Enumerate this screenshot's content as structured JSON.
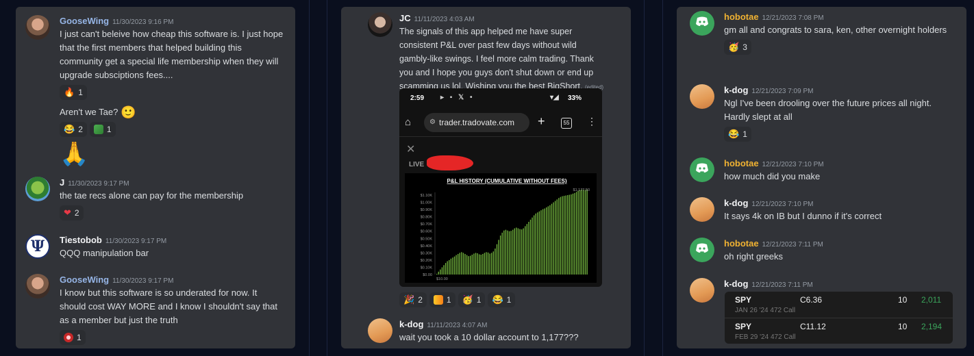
{
  "panels": {
    "left": {
      "messages": [
        {
          "author": "GooseWing",
          "timestamp": "11/30/2023 9:16 PM",
          "text": "I just can't beleive how cheap this software is.  I just hope that the first members that helped building this community get a special life membership when they will upgrade subsciptions fees....",
          "reaction": {
            "emoji": "🔥",
            "count": "1"
          },
          "followup": "Aren't we Tae?",
          "followup_emoji": "🙂",
          "followup_reactions": [
            {
              "emoji": "😂",
              "count": "2"
            },
            {
              "emoji": "custom",
              "count": "1"
            }
          ],
          "big_emoji": "🙏"
        },
        {
          "author": "J",
          "timestamp": "11/30/2023 9:17 PM",
          "text": "the tae recs alone can pay for the membership",
          "reaction": {
            "emoji": "❤",
            "count": "2"
          }
        },
        {
          "author": "Tiestobob",
          "timestamp": "11/30/2023 9:17 PM",
          "text": "QQQ manipulation bar",
          "avatar_glyph": "Ψ"
        },
        {
          "author": "GooseWing",
          "timestamp": "11/30/2023 9:17 PM",
          "text": "I know but this software is so underated for now.  It should cost WAY MORE and I know I shouldn't say that as a member but just the truth",
          "reaction": {
            "emoji": "custom",
            "count": "1"
          }
        }
      ]
    },
    "middle": {
      "messages": [
        {
          "author": "JC",
          "timestamp": "11/11/2023 4:03 AM",
          "text": "The signals of this app helped me have super consistent P&L over past few days without wild gambly-like swings. I feel more calm trading. Thank you and I hope you guys don't shut down or end up scamming us lol. Wishing you the best BigShort.",
          "edited": "(edited)",
          "reactions": [
            {
              "emoji": "🎉",
              "count": "2"
            },
            {
              "emoji": "custom",
              "count": "1"
            },
            {
              "emoji": "🥳",
              "count": "1"
            },
            {
              "emoji": "😂",
              "count": "1"
            }
          ]
        },
        {
          "author": "k-dog",
          "timestamp": "11/11/2023 4:07 AM",
          "text": "wait you took a 10 dollar account to 1,177???"
        }
      ],
      "screenshot": {
        "time": "2:59",
        "battery": "33%",
        "url": "trader.tradovate.com",
        "tabs_count": "55",
        "live_label": "LIVE"
      }
    },
    "right": {
      "messages": [
        {
          "author": "hobotae",
          "timestamp": "12/21/2023 7:08 PM",
          "text": "gm all and congrats to sara, ken, other overnight holders",
          "reaction": {
            "emoji": "🥳",
            "count": "3"
          }
        },
        {
          "author": "k-dog",
          "timestamp": "12/21/2023 7:09 PM",
          "text": "Ngl I've been drooling over the future prices all night. Hardly slept at all",
          "reaction": {
            "emoji": "😂",
            "count": "1"
          }
        },
        {
          "author": "hobotae",
          "timestamp": "12/21/2023 7:10 PM",
          "text": "how much did you make"
        },
        {
          "author": "k-dog",
          "timestamp": "12/21/2023 7:10 PM",
          "text": "It says 4k on IB but I dunno if it's correct"
        },
        {
          "author": "hobotae",
          "timestamp": "12/21/2023 7:11 PM",
          "text": "oh right greeks"
        },
        {
          "author": "k-dog",
          "timestamp": "12/21/2023 7:11 PM"
        }
      ],
      "positions": [
        {
          "symbol": "SPY",
          "strike": "C6.36",
          "qty": "10",
          "value": "2,011",
          "desc": "JAN 26 '24 472 Call"
        },
        {
          "symbol": "SPY",
          "strike": "C11.12",
          "qty": "10",
          "value": "2,194",
          "desc": "FEB 29 '24 472 Call"
        }
      ]
    }
  },
  "colors": {
    "hobotae": "#f0b232",
    "goosewing": "#96b5e6",
    "positive": "#3ba55c",
    "chart_bar": "#6fae3c"
  },
  "chart_data": {
    "type": "bar",
    "title": "P&L HISTORY (CUMULATIVE WITHOUT FEES)",
    "first_value_label": "$10.00",
    "last_value_label": "$1,177.50",
    "ytick_labels": [
      "$0.00",
      "$0.10K",
      "$0.20K",
      "$0.30K",
      "$0.40K",
      "$0.50K",
      "$0.60K",
      "$0.70K",
      "$0.80K",
      "$0.90K",
      "$1.00K",
      "$1.10K"
    ],
    "ylim": [
      0,
      1100
    ],
    "values": [
      10,
      40,
      70,
      100,
      130,
      160,
      185,
      200,
      220,
      235,
      250,
      270,
      285,
      300,
      310,
      300,
      285,
      270,
      255,
      260,
      275,
      290,
      300,
      295,
      280,
      275,
      285,
      300,
      310,
      305,
      290,
      300,
      320,
      360,
      420,
      480,
      540,
      580,
      610,
      620,
      610,
      600,
      605,
      620,
      640,
      650,
      640,
      630,
      625,
      640,
      670,
      700,
      730,
      760,
      790,
      820,
      845,
      860,
      875,
      890,
      905,
      915,
      930,
      945,
      960,
      980,
      1000,
      1020,
      1040,
      1060,
      1075,
      1085,
      1090,
      1095,
      1100,
      1105,
      1110,
      1120,
      1130,
      1145,
      1160,
      1170,
      1177.5,
      1175,
      1170,
      1177.5
    ],
    "grid": false
  }
}
